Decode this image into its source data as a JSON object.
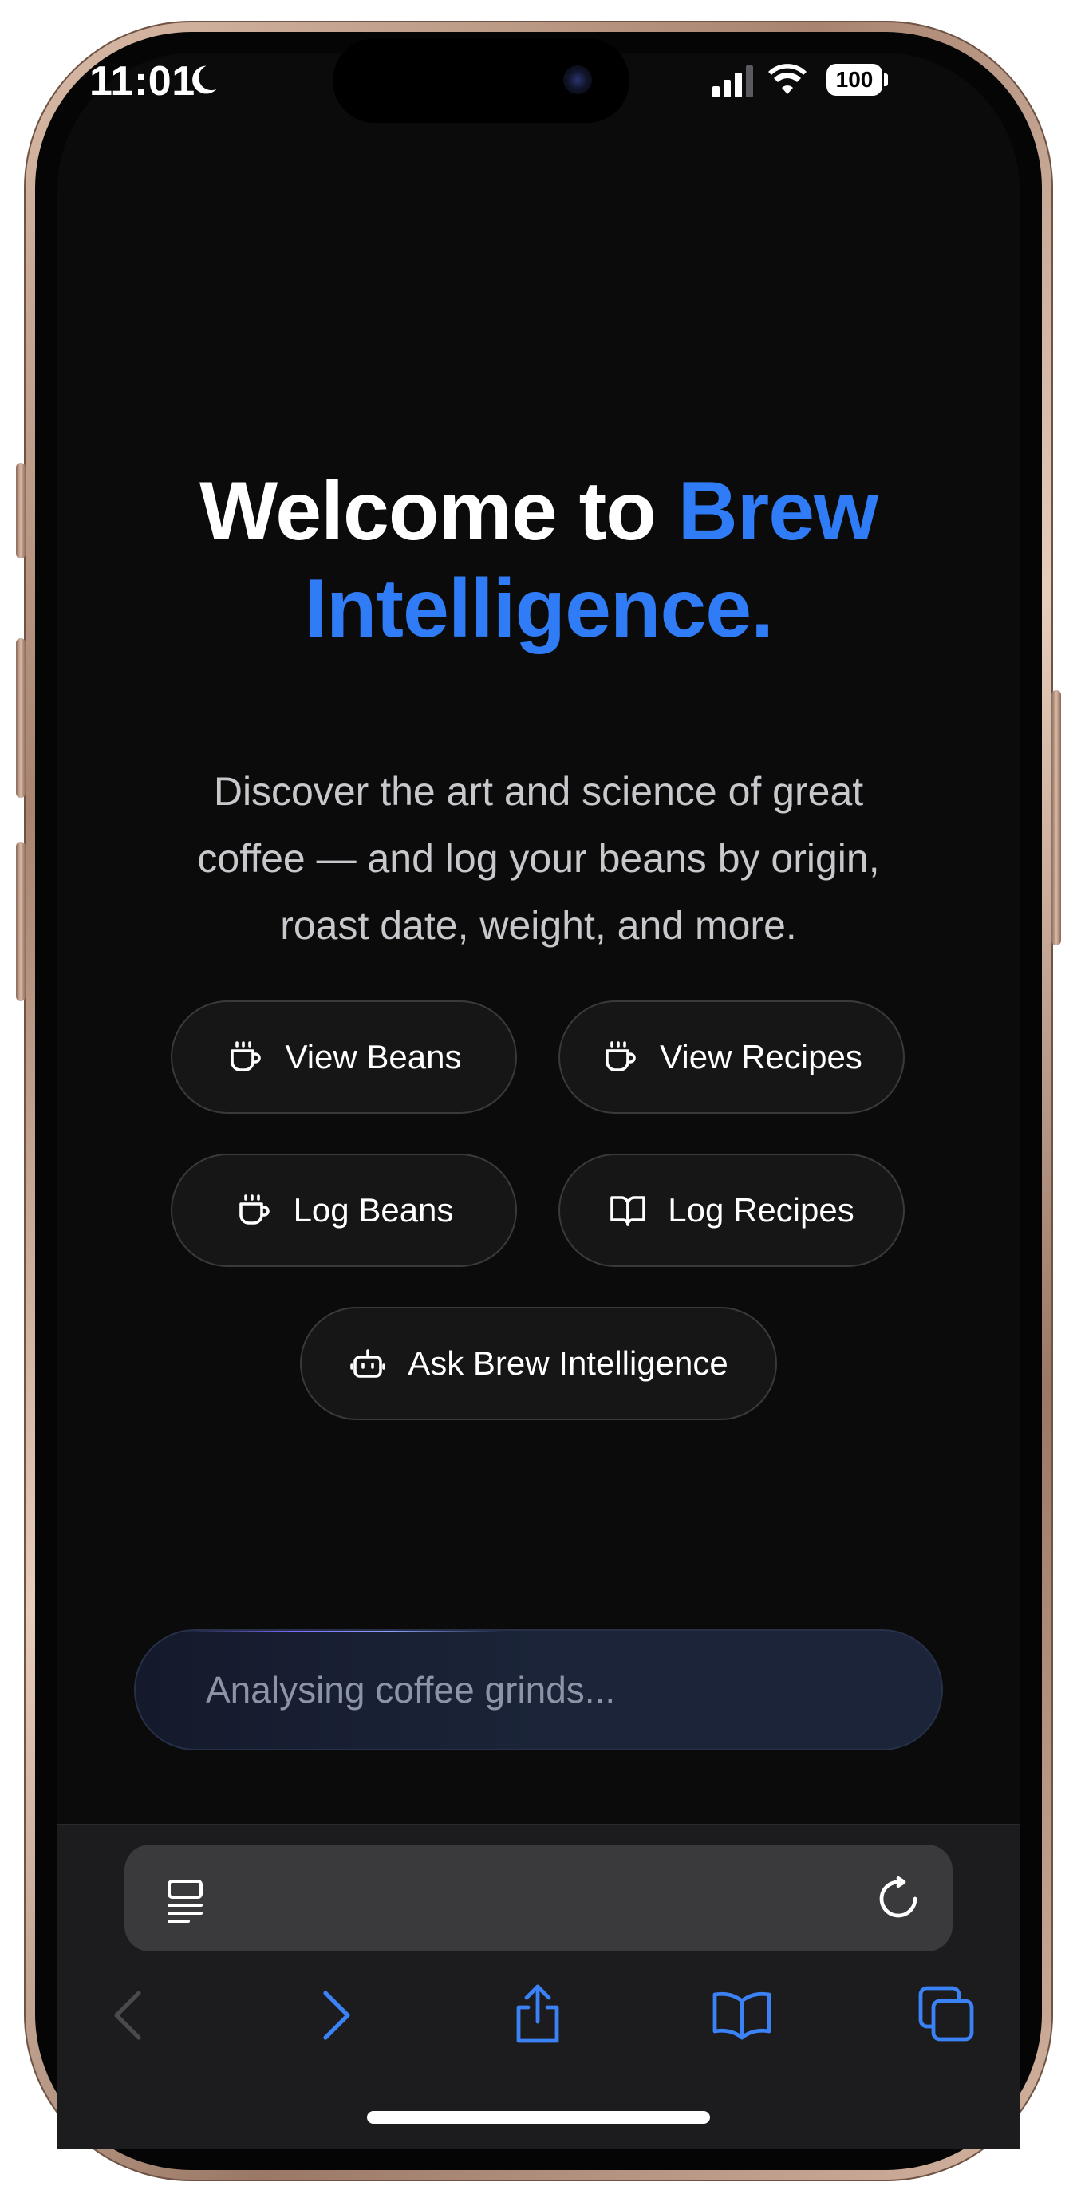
{
  "status_bar": {
    "time": "11:01",
    "battery": "100"
  },
  "hero": {
    "title_prefix": "Welcome to ",
    "title_accent": "Brew Intelligence.",
    "subtitle": "Discover the art and science of great coffee — and log your beans by origin, roast date, weight, and more."
  },
  "actions": {
    "view_beans": "View Beans",
    "view_recipes": "View Recipes",
    "log_beans": "Log Beans",
    "log_recipes": "Log Recipes",
    "ask": "Ask Brew Intelligence"
  },
  "loading": {
    "text": "Analysing coffee grinds..."
  },
  "toolbar": {
    "address": ""
  },
  "colors": {
    "accent": "#2f7cf6",
    "background": "#0b0b0b",
    "button_bg": "#161616",
    "toolbar_icon": "#3b82f6"
  },
  "icons": {
    "status": [
      "moon-icon",
      "signal-icon",
      "wifi-icon",
      "battery-icon"
    ],
    "actions": [
      "coffee-cup-icon",
      "coffee-cup-icon",
      "coffee-cup-icon",
      "open-book-icon",
      "robot-icon"
    ],
    "toolbar": [
      "reader-icon",
      "reload-icon",
      "back-icon",
      "forward-icon",
      "share-icon",
      "bookmarks-icon",
      "tabs-icon"
    ]
  }
}
